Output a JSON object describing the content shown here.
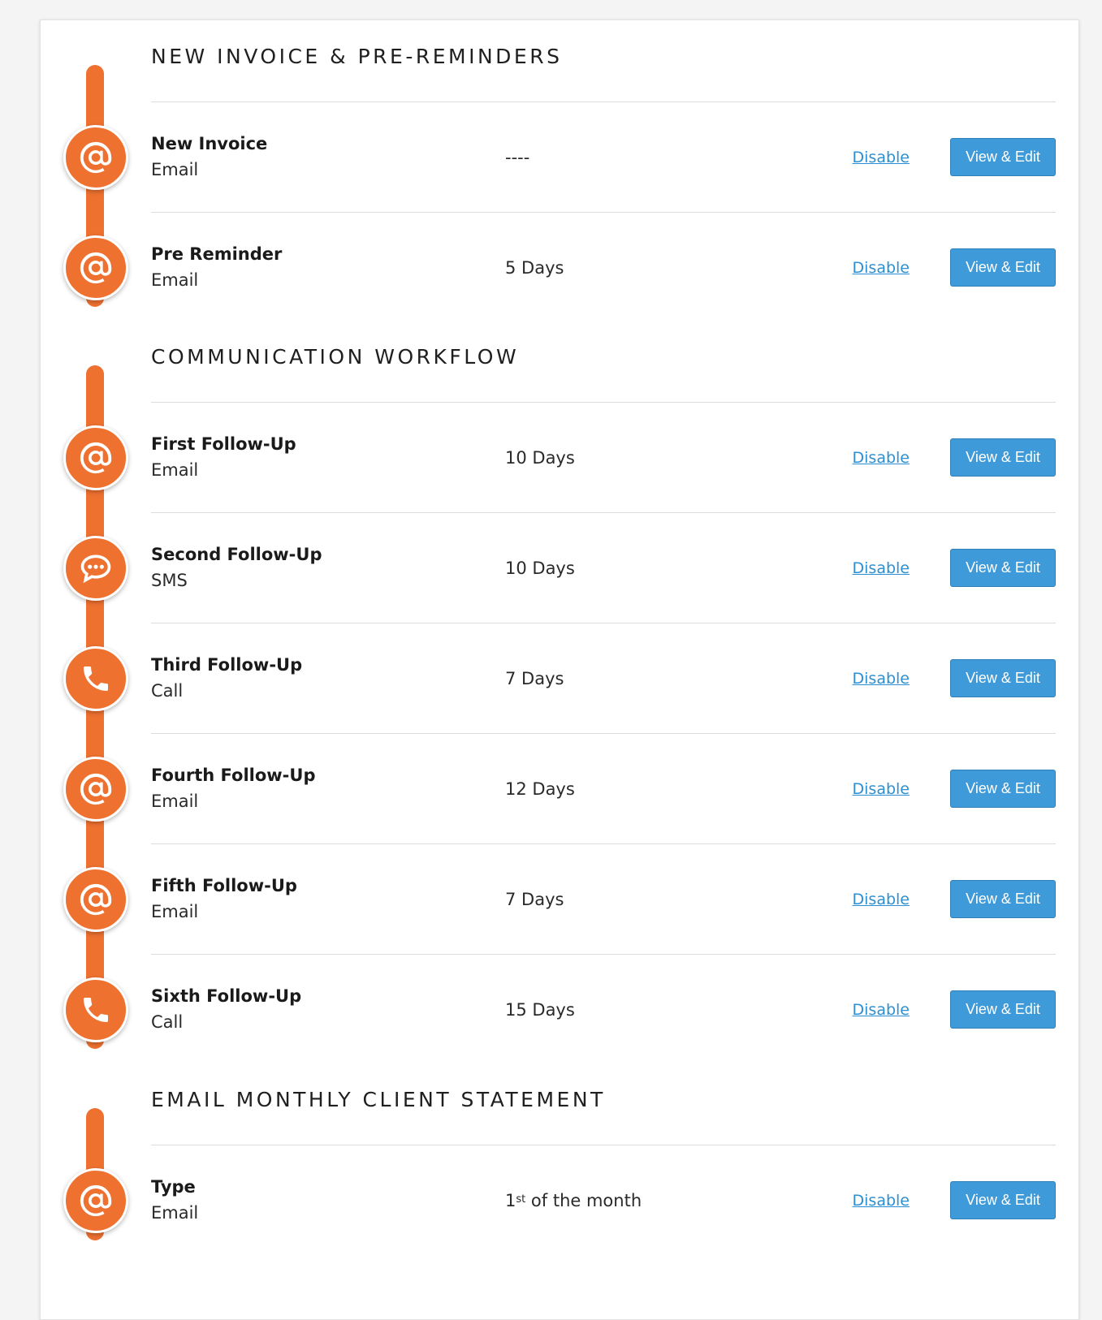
{
  "colors": {
    "accent_orange": "#ee7130",
    "button_blue": "#3f9ad9",
    "link_blue": "#2a8fd3"
  },
  "sections": [
    {
      "title": "NEW INVOICE & PRE-REMINDERS",
      "steps": [
        {
          "name": "New Invoice",
          "channel": "Email",
          "delay": "----",
          "icon": "email-at-icon",
          "disable_label": "Disable",
          "edit_label": "View & Edit"
        },
        {
          "name": "Pre Reminder",
          "channel": "Email",
          "delay": "5 Days",
          "icon": "email-at-icon",
          "disable_label": "Disable",
          "edit_label": "View & Edit"
        }
      ]
    },
    {
      "title": "COMMUNICATION WORKFLOW",
      "steps": [
        {
          "name": "First Follow-Up",
          "channel": "Email",
          "delay": "10 Days",
          "icon": "email-at-icon",
          "disable_label": "Disable",
          "edit_label": "View & Edit"
        },
        {
          "name": "Second Follow-Up",
          "channel": "SMS",
          "delay": "10 Days",
          "icon": "sms-chat-icon",
          "disable_label": "Disable",
          "edit_label": "View & Edit"
        },
        {
          "name": "Third Follow-Up",
          "channel": "Call",
          "delay": "7 Days",
          "icon": "phone-icon",
          "disable_label": "Disable",
          "edit_label": "View & Edit"
        },
        {
          "name": "Fourth Follow-Up",
          "channel": "Email",
          "delay": "12 Days",
          "icon": "email-at-icon",
          "disable_label": "Disable",
          "edit_label": "View & Edit"
        },
        {
          "name": "Fifth Follow-Up",
          "channel": "Email",
          "delay": "7 Days",
          "icon": "email-at-icon",
          "disable_label": "Disable",
          "edit_label": "View & Edit"
        },
        {
          "name": "Sixth Follow-Up",
          "channel": "Call",
          "delay": "15 Days",
          "icon": "phone-icon",
          "disable_label": "Disable",
          "edit_label": "View & Edit"
        }
      ]
    },
    {
      "title": "EMAIL MONTHLY CLIENT STATEMENT",
      "steps": [
        {
          "name": "Type",
          "channel": "Email",
          "delay": "1",
          "delay_sup": "st",
          "delay_suffix": " of the month",
          "icon": "email-at-icon",
          "disable_label": "Disable",
          "edit_label": "View & Edit"
        }
      ]
    }
  ]
}
